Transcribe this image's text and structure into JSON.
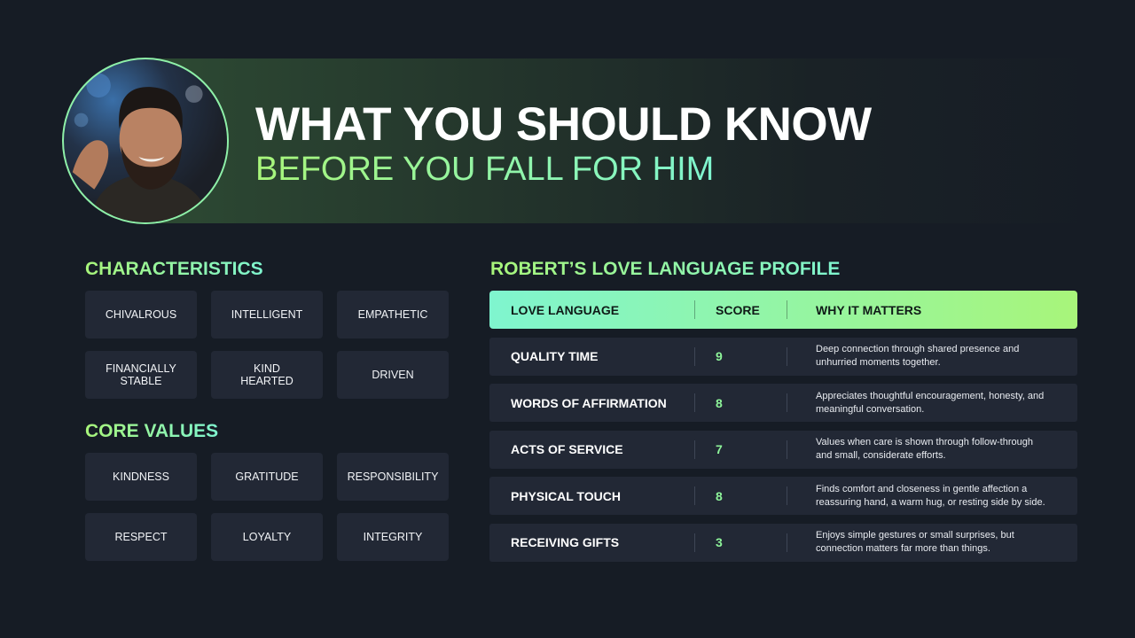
{
  "header": {
    "title": "WHAT YOU SHOULD KNOW",
    "subtitle": "BEFORE YOU FALL FOR HIM"
  },
  "characteristics": {
    "heading": "CHARACTERISTICS",
    "items": [
      "CHIVALROUS",
      "INTELLIGENT",
      "EMPATHETIC",
      "FINANCIALLY\nSTABLE",
      "KIND\nHEARTED",
      "DRIVEN"
    ]
  },
  "core_values": {
    "heading": "CORE VALUES",
    "items": [
      "KINDNESS",
      "GRATITUDE",
      "RESPONSIBILITY",
      "RESPECT",
      "LOYALTY",
      "INTEGRITY"
    ]
  },
  "love_profile": {
    "heading": "ROBERT’S LOVE LANGUAGE PROFILE",
    "columns": [
      "LOVE LANGUAGE",
      "SCORE",
      "WHY IT MATTERS"
    ],
    "rows": [
      {
        "language": "QUALITY TIME",
        "score": "9",
        "why": "Deep connection through shared presence and unhurried moments together."
      },
      {
        "language": "WORDS OF AFFIRMATION",
        "score": "8",
        "why": "Appreciates thoughtful encouragement, honesty, and meaningful conversation."
      },
      {
        "language": "ACTS OF SERVICE",
        "score": "7",
        "why": "Values when care is shown through follow-through and small, considerate efforts."
      },
      {
        "language": "PHYSICAL TOUCH",
        "score": "8",
        "why": "Finds comfort and closeness in gentle affection a reassuring hand, a warm hug, or resting side by side."
      },
      {
        "language": "RECEIVING GIFTS",
        "score": "3",
        "why": "Enjoys simple gestures or small surprises, but connection matters far more than things."
      }
    ]
  },
  "colors": {
    "background": "#161c25",
    "tile": "#222835",
    "accent_green": "#a8f57a",
    "accent_teal": "#7ff5cf"
  }
}
